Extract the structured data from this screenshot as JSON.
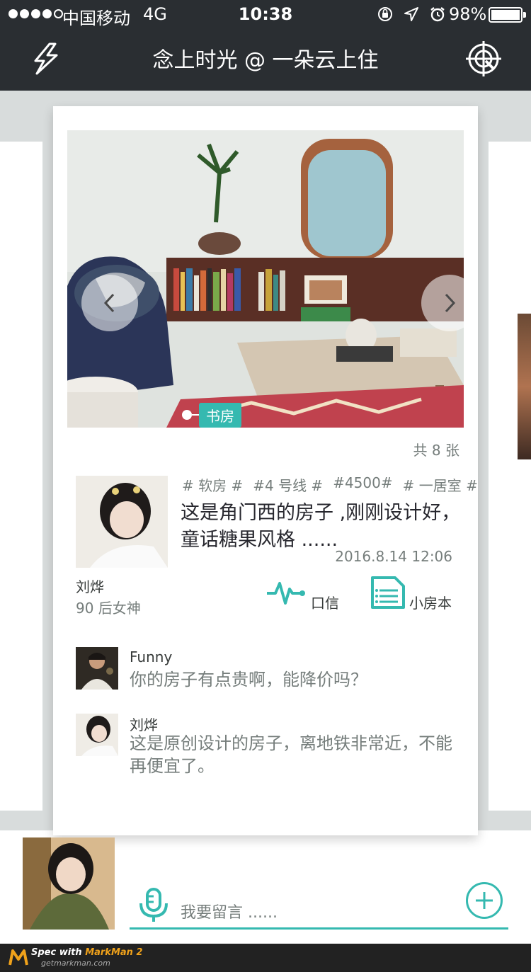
{
  "status_bar": {
    "carrier": "中国移动",
    "network": "4G",
    "time": "10:38",
    "battery": "98%",
    "icons": [
      "orientation-lock-icon",
      "location-arrow-icon",
      "alarm-icon",
      "battery-icon"
    ]
  },
  "nav": {
    "title": "念上时光 @ 一朵云上住",
    "left_icon": "lightning-icon",
    "right_icon": "target-icon"
  },
  "listing": {
    "room_tag": "书房",
    "photo_count": "共 8 张",
    "tags": [
      "# 软房 #",
      "#4 号线 #",
      "#4500#",
      "# 一居室 #"
    ],
    "description": "这是角门西的房子 ,刚刚设计好，童话糖果风格 ......",
    "date": "2016.8.14 12:06",
    "owner": {
      "name": "刘烨",
      "subtitle": "90 后女神"
    },
    "actions": [
      {
        "label": "口信",
        "icon": "pulse-icon"
      },
      {
        "label": "小房本",
        "icon": "document-icon"
      }
    ]
  },
  "comments": [
    {
      "name": "Funny",
      "text": "你的房子有点贵啊，能降价吗？"
    },
    {
      "name": "刘烨",
      "text": "这是原创设计的房子，离地铁非常近，不能再便宜了。"
    }
  ],
  "composer": {
    "placeholder": "我要留言 ......",
    "mic_icon": "microphone-icon",
    "add_icon": "plus-circle-icon"
  },
  "footer": {
    "brand_prefix": "Spec with ",
    "brand_name": "MarkMan 2",
    "url": "getmarkman.com"
  },
  "colors": {
    "accent": "#35b9b0",
    "topbar": "#2a2e32",
    "text_dark": "#373b3a",
    "text_gray": "#757d7b",
    "text_desc": "#27272e"
  }
}
